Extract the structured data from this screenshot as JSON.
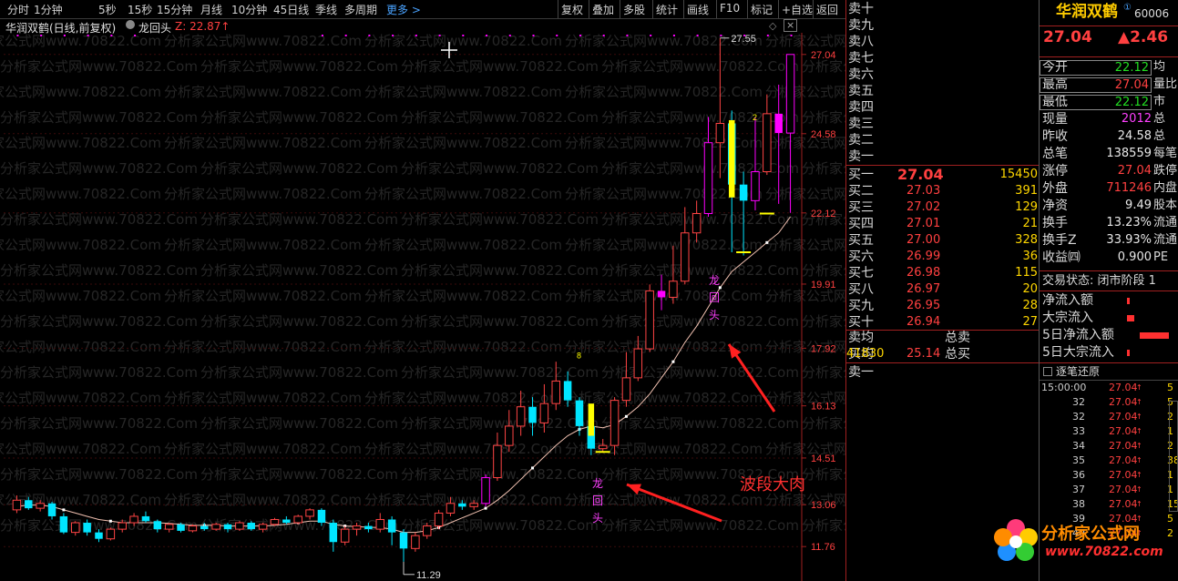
{
  "toolbar": {
    "periods": [
      "分时",
      "1分钟",
      "5秒",
      "15秒",
      "15分钟",
      "月线",
      "10分钟",
      "45日线",
      "季线",
      "多周期"
    ],
    "more": "更多 >",
    "tools": [
      "复权",
      "叠加",
      "多股",
      "统计",
      "画线",
      "F10",
      "标记",
      "+自选",
      "返回"
    ]
  },
  "chart_header": {
    "stock": "华润双鹤(日线,前复权)",
    "indicator": "龙回头",
    "indicator_value": "Z: 22.87↑"
  },
  "annotations": {
    "high_label": "27.55",
    "low_label": "11.29",
    "signal_text_1": "龙\n回\n头",
    "signal_text_2": "龙\n回\n头",
    "wave_label": "波段大肉",
    "marker_2": "2",
    "marker_8": "8"
  },
  "price_axis": [
    "27.04",
    "24.58",
    "22.12",
    "19.91",
    "17.92",
    "16.13",
    "14.51",
    "13.06",
    "11.76"
  ],
  "colors": {
    "up": "#ff4444",
    "down": "#00e5ff",
    "ma": "#f0c0b0",
    "dots": "#ff00ff",
    "limit_up": "#ff00ff",
    "signal_line": "#ffff00",
    "accent_red": "#ff4040"
  },
  "chart_data": {
    "type": "candlestick",
    "candles": [
      [
        12.9,
        13.2,
        13.35,
        12.8
      ],
      [
        13.2,
        12.95,
        13.3,
        12.9
      ],
      [
        12.95,
        13.1,
        13.2,
        12.85
      ],
      [
        13.1,
        12.7,
        13.15,
        12.6
      ],
      [
        12.7,
        12.2,
        12.8,
        12.15
      ],
      [
        12.2,
        12.5,
        12.55,
        12.1
      ],
      [
        12.5,
        12.2,
        12.6,
        12.1
      ],
      [
        12.2,
        12.0,
        12.3,
        11.9
      ],
      [
        12.0,
        12.3,
        12.35,
        11.95
      ],
      [
        12.3,
        12.5,
        12.6,
        12.2
      ],
      [
        12.5,
        12.7,
        12.8,
        12.4
      ],
      [
        12.7,
        12.55,
        12.85,
        12.5
      ],
      [
        12.55,
        12.3,
        12.6,
        12.2
      ],
      [
        12.3,
        12.45,
        12.5,
        12.2
      ],
      [
        12.45,
        12.25,
        12.5,
        12.2
      ],
      [
        12.25,
        12.4,
        12.45,
        12.2
      ],
      [
        12.4,
        12.3,
        12.5,
        12.25
      ],
      [
        12.3,
        12.45,
        12.5,
        12.25
      ],
      [
        12.45,
        12.3,
        12.5,
        12.2
      ],
      [
        12.3,
        12.5,
        12.55,
        12.25
      ],
      [
        12.5,
        12.3,
        12.55,
        12.25
      ],
      [
        12.3,
        12.45,
        12.5,
        12.2
      ],
      [
        12.45,
        12.6,
        12.65,
        12.4
      ],
      [
        12.6,
        12.5,
        12.7,
        12.45
      ],
      [
        12.5,
        12.7,
        12.75,
        12.45
      ],
      [
        12.7,
        12.9,
        12.95,
        12.6
      ],
      [
        12.9,
        12.5,
        12.95,
        12.4
      ],
      [
        12.5,
        11.9,
        12.6,
        11.6
      ],
      [
        11.9,
        12.3,
        12.4,
        11.8
      ],
      [
        12.3,
        12.4,
        12.5,
        12.1
      ],
      [
        12.4,
        12.3,
        12.5,
        12.2
      ],
      [
        12.3,
        12.6,
        12.8,
        12.2
      ],
      [
        12.6,
        12.2,
        12.7,
        11.8
      ],
      [
        12.2,
        11.7,
        12.3,
        11.29
      ],
      [
        11.7,
        12.1,
        12.2,
        11.6
      ],
      [
        12.1,
        12.4,
        12.5,
        12.0
      ],
      [
        12.4,
        12.8,
        12.9,
        12.3
      ],
      [
        12.8,
        13.1,
        13.3,
        12.7
      ],
      [
        13.1,
        13.0,
        13.2,
        12.9
      ],
      [
        13.0,
        13.1,
        13.2,
        12.9
      ],
      [
        13.1,
        13.9,
        14.0,
        13.0
      ],
      [
        13.9,
        14.9,
        15.3,
        13.8
      ],
      [
        14.9,
        15.5,
        16.0,
        14.7
      ],
      [
        15.5,
        16.1,
        16.6,
        15.2
      ],
      [
        16.1,
        15.6,
        16.4,
        15.2
      ],
      [
        15.6,
        16.2,
        16.8,
        15.3
      ],
      [
        16.2,
        16.9,
        17.5,
        16.0
      ],
      [
        16.9,
        16.3,
        17.2,
        16.1
      ],
      [
        16.3,
        15.5,
        16.4,
        15.2
      ],
      [
        15.5,
        14.8,
        15.6,
        14.6
      ],
      [
        14.8,
        14.9,
        15.1,
        14.7
      ],
      [
        14.9,
        16.3,
        16.4,
        14.6
      ],
      [
        16.3,
        17.0,
        17.8,
        16.1
      ],
      [
        17.0,
        17.9,
        18.3,
        16.9
      ],
      [
        17.9,
        19.7,
        19.9,
        17.8
      ],
      [
        19.7,
        19.5,
        20.2,
        19.1
      ],
      [
        19.5,
        20.0,
        21.1,
        19.3
      ],
      [
        20.0,
        21.5,
        22.3,
        19.9
      ],
      [
        21.5,
        22.1,
        22.5,
        21.2
      ],
      [
        22.1,
        24.3,
        25.1,
        22.0
      ],
      [
        24.3,
        24.9,
        27.55,
        23.2
      ],
      [
        24.9,
        23.0,
        25.3,
        20.9
      ],
      [
        23.0,
        22.5,
        23.4,
        20.8
      ],
      [
        22.5,
        23.4,
        25.1,
        22.2
      ],
      [
        23.4,
        25.2,
        25.8,
        23.3
      ],
      [
        25.2,
        24.6,
        26.1,
        22.4
      ],
      [
        24.6,
        27.04,
        27.04,
        22.12
      ]
    ],
    "ma": [
      13.0,
      13.05,
      13.05,
      13.0,
      12.9,
      12.8,
      12.7,
      12.6,
      12.55,
      12.5,
      12.5,
      12.5,
      12.5,
      12.48,
      12.45,
      12.42,
      12.42,
      12.42,
      12.4,
      12.4,
      12.4,
      12.4,
      12.42,
      12.45,
      12.5,
      12.55,
      12.55,
      12.45,
      12.4,
      12.38,
      12.36,
      12.35,
      12.3,
      12.2,
      12.2,
      12.25,
      12.35,
      12.5,
      12.65,
      12.8,
      12.95,
      13.2,
      13.5,
      13.85,
      14.2,
      14.55,
      14.9,
      15.2,
      15.4,
      15.5,
      15.45,
      15.55,
      15.8,
      16.1,
      16.5,
      17.0,
      17.5,
      18.1,
      18.6,
      19.2,
      19.8,
      20.3,
      20.6,
      20.9,
      21.2,
      21.5,
      22.0
    ],
    "limit_up_index": [
      40,
      55,
      59,
      63,
      65,
      66
    ],
    "price_max": 27.6,
    "price_min": 11.2
  },
  "sell_book": {
    "labels": [
      "卖十",
      "卖九",
      "卖八",
      "卖七",
      "卖六",
      "卖五",
      "卖四",
      "卖三",
      "卖二",
      "卖一"
    ]
  },
  "buy_book": [
    {
      "label": "买一",
      "price": "27.04",
      "vol": "15450"
    },
    {
      "label": "买二",
      "price": "27.03",
      "vol": "391"
    },
    {
      "label": "买三",
      "price": "27.02",
      "vol": "129"
    },
    {
      "label": "买四",
      "price": "27.01",
      "vol": "21"
    },
    {
      "label": "买五",
      "price": "27.00",
      "vol": "328"
    },
    {
      "label": "买六",
      "price": "26.99",
      "vol": "36"
    },
    {
      "label": "买七",
      "price": "26.98",
      "vol": "115"
    },
    {
      "label": "买八",
      "price": "26.97",
      "vol": "20"
    },
    {
      "label": "买九",
      "price": "26.95",
      "vol": "28"
    },
    {
      "label": "买十",
      "price": "26.94",
      "vol": "27"
    }
  ],
  "averages": {
    "sell_avg_label": "卖均",
    "sell_total_label": "总卖",
    "buy_avg_label": "买均",
    "buy_avg": "25.14",
    "buy_total_label": "总买",
    "buy_total": "41830",
    "sell1_label": "卖一"
  },
  "info": {
    "name": "华润双鹤",
    "code": "60006",
    "price": "27.04",
    "change": "▲2.46",
    "rows": [
      {
        "l": "今开",
        "v": "22.12",
        "c": "green",
        "r": "均"
      },
      {
        "l": "最高",
        "v": "27.04",
        "c": "red",
        "r": "量比"
      },
      {
        "l": "最低",
        "v": "22.12",
        "c": "green",
        "r": "市"
      },
      {
        "l": "现量",
        "v": "2012",
        "c": "mag",
        "r": "总"
      },
      {
        "l": "昨收",
        "v": "24.58",
        "c": "white",
        "r": "总"
      },
      {
        "l": "总笔",
        "v": "138559",
        "c": "white",
        "r": "每笔"
      },
      {
        "l": "涨停",
        "v": "27.04",
        "c": "red",
        "r": "跌停"
      },
      {
        "l": "外盘",
        "v": "711246",
        "c": "red",
        "r": "内盘"
      },
      {
        "l": "净资",
        "v": "9.49",
        "c": "white",
        "r": "股本"
      },
      {
        "l": "换手",
        "v": "13.23%",
        "c": "white",
        "r": "流通"
      },
      {
        "l": "换手Z",
        "v": "33.93%",
        "c": "white",
        "r": "流通"
      },
      {
        "l": "收益㈣",
        "v": "0.900",
        "c": "white",
        "r": "PE"
      }
    ],
    "status": "交易状态: 闭市阶段 1",
    "flows": [
      "净流入额",
      "大宗流入",
      "5日净流入额",
      "5日大宗流入"
    ],
    "tick_title": "逐笔还原",
    "ticks": [
      {
        "t": "15:00:00",
        "p": "27.04",
        "v": "5"
      },
      {
        "t": "32",
        "p": "27.04",
        "v": "5"
      },
      {
        "t": "32",
        "p": "27.04",
        "v": "2"
      },
      {
        "t": "33",
        "p": "27.04",
        "v": "1"
      },
      {
        "t": "34",
        "p": "27.04",
        "v": "2"
      },
      {
        "t": "35",
        "p": "27.04",
        "v": "38"
      },
      {
        "t": "36",
        "p": "27.04",
        "v": "1"
      },
      {
        "t": "37",
        "p": "27.04",
        "v": "1"
      },
      {
        "t": "38",
        "p": "27.04",
        "v": "15"
      },
      {
        "t": "39",
        "p": "27.04",
        "v": "5"
      },
      {
        "t": "40",
        "p": "27.04",
        "v": "2"
      }
    ]
  },
  "watermark": {
    "brand": "分析家公式网",
    "url": "www.70822.com",
    "repeat": "分析家公式网www.70822.Com"
  }
}
